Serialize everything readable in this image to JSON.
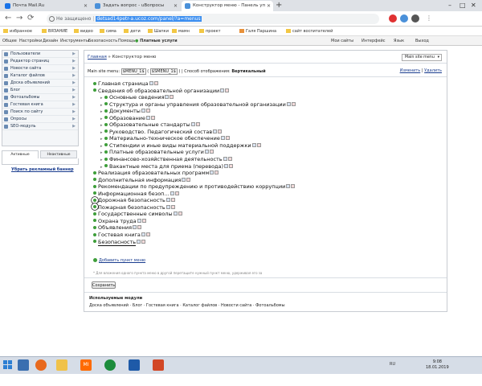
{
  "browser": {
    "tabs": [
      {
        "label": "Почта Mail.Ru",
        "color": "#1a73e8"
      },
      {
        "label": "Задать вопрос - uВопросы",
        "color": "#4a90d9"
      },
      {
        "label": "Конструктор меню - Панель уп",
        "color": "#4a90d9"
      }
    ],
    "newtab": "+",
    "insecure_label": "Не защищено",
    "url": "detsad14petr-a.ucoz.com/panel/?a=menus",
    "window_controls": [
      "–",
      "□",
      "✕"
    ],
    "bookmarks": [
      "избранное",
      "ВЯЗАНИЕ",
      "видео",
      "сима",
      "дети",
      "Шапки",
      "мамн",
      "проект",
      "Галя Паршина",
      "сайт воспитателей"
    ],
    "ucoz_left": [
      "Общее",
      "Настройки",
      "Дизайн",
      "Инструменты",
      "Безопасность",
      "Помощь",
      "Платные услуги"
    ],
    "ucoz_right": [
      "Мои сайты",
      "Интерфейс",
      "Язык",
      "Выход"
    ]
  },
  "sidebar": {
    "items": [
      {
        "label": "Пользователи"
      },
      {
        "label": "Редактор страниц"
      },
      {
        "label": "Новости сайта"
      },
      {
        "label": "Каталог файлов"
      },
      {
        "label": "Доска объявлений"
      },
      {
        "label": "Блог"
      },
      {
        "label": "Фотоальбомы"
      },
      {
        "label": "Гостевая книга"
      },
      {
        "label": "Поиск по сайту"
      },
      {
        "label": "Опросы"
      },
      {
        "label": "SEO-модуль"
      }
    ],
    "tab_active": "Активные",
    "tab_inactive": "Неактивные",
    "banner_link": "Убрать рекламный баннер"
  },
  "main": {
    "breadcrumb_home": "Главная",
    "breadcrumb_sep": " » ",
    "breadcrumb_current": "Конструктор меню",
    "menu_select": "Main site menu",
    "info_prefix": "Main site menu: ",
    "code1": "$MENU_1$",
    "code_mid": " ( ",
    "code2": "$SMENU_1$",
    "info_suffix": " ) | Способ отображения: ",
    "display_mode": "Вертикальный",
    "action_edit": "Изменить",
    "action_delete": "Удалить",
    "tree": [
      {
        "label": "Главная страница",
        "level": 0
      },
      {
        "label": "Сведения об образовательной организации",
        "level": 0
      },
      {
        "label": "Основные сведения",
        "level": 1
      },
      {
        "label": "Структура и органы управления образовательной организации",
        "level": 1
      },
      {
        "label": "Документы",
        "level": 1
      },
      {
        "label": "Образование",
        "level": 1
      },
      {
        "label": "Образовательные стандарты",
        "level": 1
      },
      {
        "label": "Руководство. Педагогический состав",
        "level": 1
      },
      {
        "label": "Материально-техническое обеспечение",
        "level": 1
      },
      {
        "label": "Стипендии и иные виды материальной поддержки",
        "level": 1
      },
      {
        "label": "Платные образовательные услуги",
        "level": 1
      },
      {
        "label": "Финансово-хозяйственная деятельность",
        "level": 1
      },
      {
        "label": "Вакантные места для приема (перевода)",
        "level": 1
      },
      {
        "label": "Реализация образовательных программ",
        "level": 0
      },
      {
        "label": "Дополнительная информация",
        "level": 0
      },
      {
        "label": "Рекомендации по предупреждению и противодействию коррупции",
        "level": 0
      },
      {
        "label": "Информационная безоп...",
        "level": 0
      },
      {
        "label": "Дорожная безопасность",
        "level": 0,
        "circled": true
      },
      {
        "label": "Пожарная безопасность",
        "level": 0,
        "circled": true
      },
      {
        "label": "Государственные символы",
        "level": 0
      },
      {
        "label": "Охрана труда",
        "level": 0
      },
      {
        "label": "Объявления",
        "level": 0
      },
      {
        "label": "Гостевая книга",
        "level": 0
      },
      {
        "label": "Безопасность",
        "level": 0,
        "underline": true
      }
    ],
    "add_item": "Добавить пункт меню",
    "hint": "* Для вложения одного пункта меню в другой перетащите нужный пункт меню, удерживая его за",
    "save": "Сохранить",
    "modules_title": "Используемые модули",
    "modules": "Доска объявлений · Блог · Гостевая книга · Каталог файлов · Новости сайта · Фотоальбомы"
  },
  "taskbar": {
    "tray_lang": "RU",
    "time": "9:08",
    "date": "18.01.2019"
  }
}
